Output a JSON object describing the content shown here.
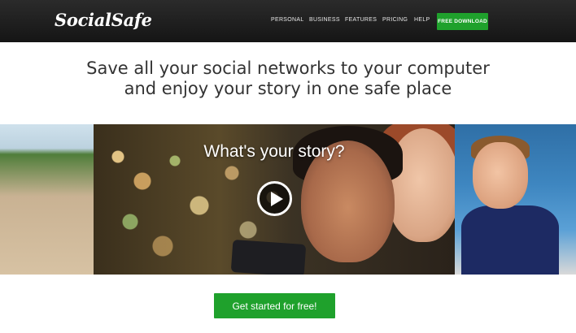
{
  "header": {
    "logo": "SocialSafe",
    "nav": [
      "PERSONAL",
      "BUSINESS",
      "FEATURES",
      "PRICING",
      "HELP"
    ],
    "cta_label": "FREE DOWNLOAD"
  },
  "headline": {
    "line1": "Save all your social networks to your computer",
    "line2": "and enjoy your story in one safe place"
  },
  "hero": {
    "title": "What's your story?"
  },
  "cta": {
    "label": "Get started for free!"
  },
  "colors": {
    "header_bg": "#1c1c1c",
    "accent_green": "#1fa12c",
    "headline_text": "#333333"
  },
  "icons": [
    "play-icon"
  ]
}
